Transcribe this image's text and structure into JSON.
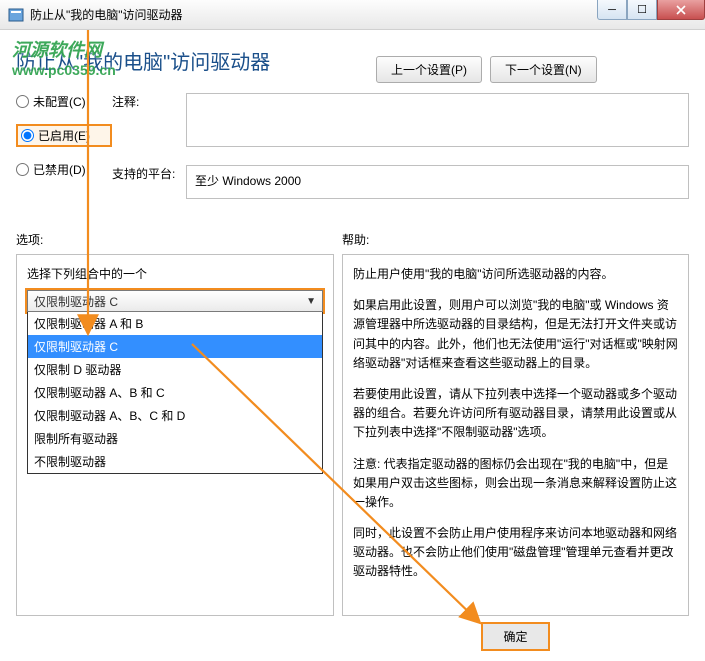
{
  "window": {
    "title": "防止从\"我的电脑\"访问驱动器"
  },
  "watermark": {
    "line1": "河源软件网",
    "line2": "www.pc0359.cn"
  },
  "header": {
    "heading": "防止从\"我的电脑\"访问驱动器",
    "prev_btn": "上一个设置(P)",
    "next_btn": "下一个设置(N)"
  },
  "radios": {
    "unconfigured": "未配置(C)",
    "enabled": "已启用(E)",
    "disabled": "已禁用(D)"
  },
  "fields": {
    "comment_label": "注释:",
    "platform_label": "支持的平台:",
    "platform_value": "至少 Windows 2000"
  },
  "panes": {
    "options_label": "选项:",
    "help_label": "帮助:"
  },
  "options": {
    "instruction": "选择下列组合中的一个",
    "selected": "仅限制驱动器 C",
    "items": [
      "仅限制驱动器 A 和 B",
      "仅限制驱动器 C",
      "仅限制 D 驱动器",
      "仅限制驱动器 A、B 和 C",
      "仅限制驱动器 A、B、C 和 D",
      "限制所有驱动器",
      "不限制驱动器"
    ]
  },
  "help": {
    "p1": "防止用户使用\"我的电脑\"访问所选驱动器的内容。",
    "p2": "如果启用此设置，则用户可以浏览\"我的电脑\"或 Windows 资源管理器中所选驱动器的目录结构，但是无法打开文件夹或访问其中的内容。此外，他们也无法使用\"运行\"对话框或\"映射网络驱动器\"对话框来查看这些驱动器上的目录。",
    "p3": "若要使用此设置，请从下拉列表中选择一个驱动器或多个驱动器的组合。若要允许访问所有驱动器目录，请禁用此设置或从下拉列表中选择\"不限制驱动器\"选项。",
    "p4": "注意: 代表指定驱动器的图标仍会出现在\"我的电脑\"中，但是如果用户双击这些图标，则会出现一条消息来解释设置防止这一操作。",
    "p5": "同时，此设置不会防止用户使用程序来访问本地驱动器和网络驱动器。也不会防止他们使用\"磁盘管理\"管理单元查看并更改驱动器特性。"
  },
  "buttons": {
    "ok": "确定"
  }
}
